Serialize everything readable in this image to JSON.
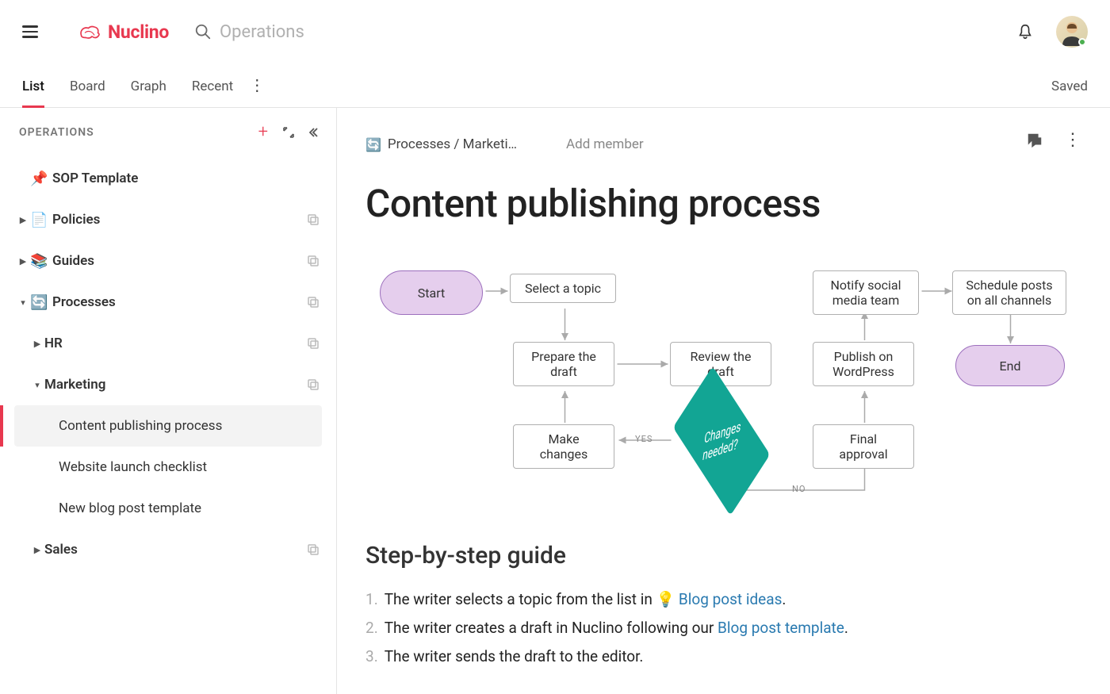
{
  "app": {
    "brand": "Nuclino",
    "search_placeholder": "Operations",
    "saved_label": "Saved"
  },
  "tabs": {
    "list": "List",
    "board": "Board",
    "graph": "Graph",
    "recent": "Recent"
  },
  "sidebar": {
    "title": "OPERATIONS",
    "pinned": {
      "label": "SOP Template",
      "icon": "📌"
    },
    "items": [
      {
        "label": "Policies",
        "icon": "📄"
      },
      {
        "label": "Guides",
        "icon": "📚"
      },
      {
        "label": "Processes",
        "icon": "🔄"
      }
    ],
    "processes_children": [
      {
        "label": "HR"
      },
      {
        "label": "Marketing"
      },
      {
        "label": "Sales"
      }
    ],
    "marketing_children": [
      {
        "label": "Content publishing process"
      },
      {
        "label": "Website launch checklist"
      },
      {
        "label": "New blog post template"
      }
    ]
  },
  "doc": {
    "crumb": "Processes / Marketi…",
    "add_member": "Add member",
    "title": "Content publishing process",
    "guide_heading": "Step-by-step guide",
    "steps": [
      {
        "prefix": "The writer selects a topic from the list in ",
        "emoji": "💡",
        "link": "Blog post ideas",
        "suffix": "."
      },
      {
        "prefix": "The writer creates a draft in Nuclino following our ",
        "emoji": "",
        "link": "Blog post template",
        "suffix": "."
      },
      {
        "prefix": "The writer sends the draft to the editor.",
        "emoji": "",
        "link": "",
        "suffix": ""
      }
    ]
  },
  "flow": {
    "start": "Start",
    "select": "Select a topic",
    "prepare": "Prepare the draft",
    "review": "Review the draft",
    "changes_q": "Changes needed?",
    "make_changes": "Make changes",
    "approval": "Final approval",
    "publish": "Publish on WordPress",
    "notify": "Notify social media team",
    "schedule": "Schedule posts on all channels",
    "end": "End",
    "yes": "YES",
    "no": "NO"
  }
}
